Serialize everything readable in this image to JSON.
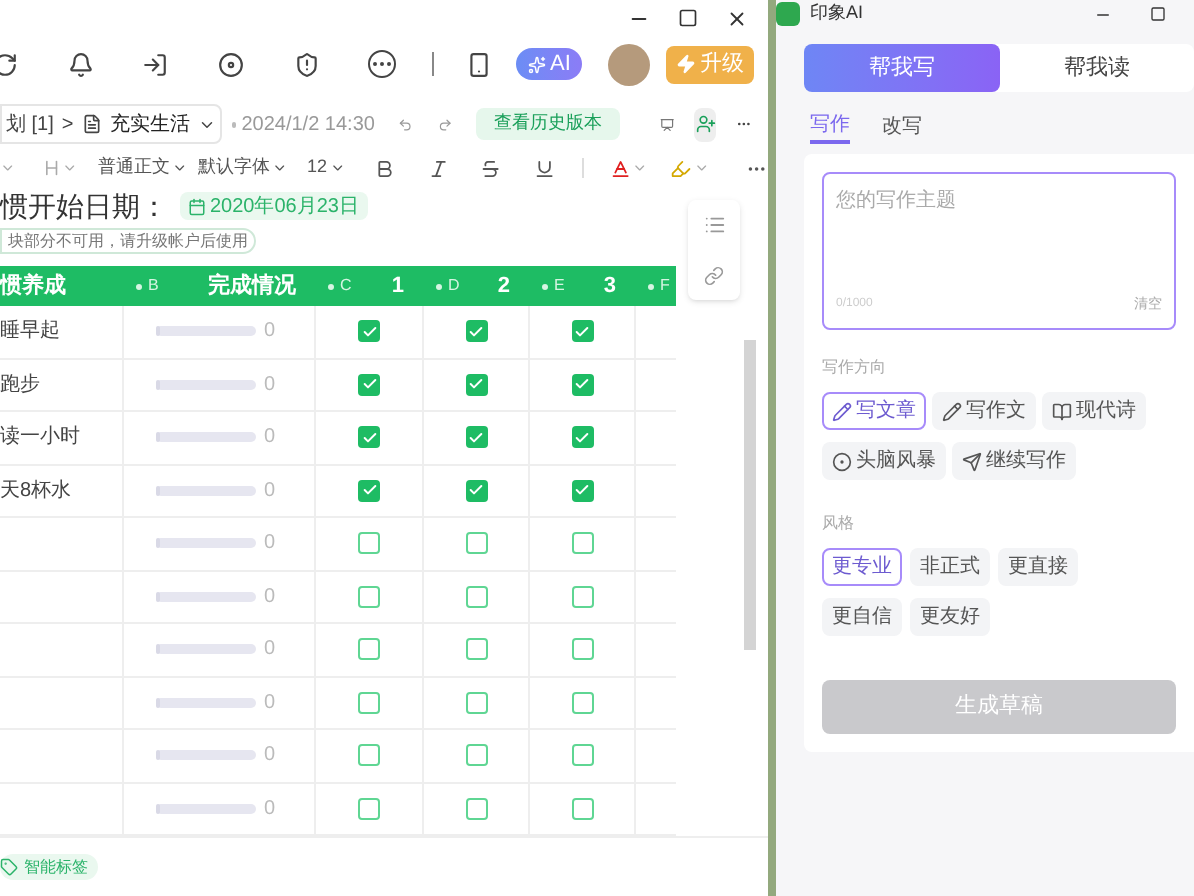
{
  "toolbar": {
    "ai_label": "AI",
    "upgrade_label": "升级"
  },
  "doc_bar": {
    "breadcrumb": "划 [1]",
    "separator": ">",
    "doc_title": "充实生活",
    "timestamp": "2024/1/2 14:30",
    "history_button": "查看历史版本"
  },
  "format_bar": {
    "paragraph_style": "普通正文",
    "font": "默认字体",
    "size": "12"
  },
  "start_date": {
    "label": "惯开始日期：",
    "value": "2020年06月23日"
  },
  "notice": "块部分不可用，请升级帐户后使用",
  "table": {
    "columns": [
      {
        "title": "惯养成"
      },
      {
        "letter": "B",
        "title": "完成情况"
      },
      {
        "letter": "C",
        "title": "1"
      },
      {
        "letter": "D",
        "title": "2"
      },
      {
        "letter": "E",
        "title": "3"
      },
      {
        "letter": "F"
      }
    ],
    "rows": [
      {
        "name": "睡早起",
        "level": 0,
        "count": "0",
        "checks": [
          true,
          true,
          true
        ]
      },
      {
        "name": "跑步",
        "level": 0,
        "count": "0",
        "checks": [
          true,
          true,
          true
        ]
      },
      {
        "name": "读一小时",
        "level": 0,
        "count": "0",
        "checks": [
          true,
          true,
          true
        ]
      },
      {
        "name": "天8杯水",
        "level": 0,
        "count": "0",
        "checks": [
          true,
          true,
          true
        ]
      },
      {
        "level": 0,
        "count": "0",
        "checks": [
          false,
          false,
          false
        ]
      },
      {
        "level": 0,
        "count": "0",
        "checks": [
          false,
          false,
          false
        ]
      },
      {
        "level": 0,
        "count": "0",
        "checks": [
          false,
          false,
          false
        ]
      },
      {
        "level": 0,
        "count": "0",
        "checks": [
          false,
          false,
          false
        ]
      },
      {
        "level": 0,
        "count": "0",
        "checks": [
          false,
          false,
          false
        ]
      },
      {
        "level": 0,
        "count": "0",
        "checks": [
          false,
          false,
          false
        ]
      }
    ]
  },
  "tag_button": "智能标签",
  "ai_panel": {
    "title": "印象AI",
    "tabs": [
      {
        "label": "帮我写",
        "selected": true
      },
      {
        "label": "帮我读",
        "selected": false
      }
    ],
    "subtabs": [
      {
        "label": "写作",
        "selected": true
      },
      {
        "label": "改写",
        "selected": false
      }
    ],
    "textarea": {
      "placeholder": "您的写作主题",
      "counter": "0/1000",
      "clear": "清空"
    },
    "direction_label": "写作方向",
    "directions": [
      {
        "label": "写文章",
        "kind": "pencil",
        "selected": true
      },
      {
        "label": "写作文",
        "kind": "pencil",
        "selected": false
      },
      {
        "label": "现代诗",
        "kind": "book",
        "selected": false
      },
      {
        "label": "头脑风暴",
        "kind": "brain",
        "selected": false
      },
      {
        "label": "继续写作",
        "kind": "continue",
        "selected": false
      }
    ],
    "style_label": "风格",
    "styles": [
      {
        "label": "更专业",
        "selected": true
      },
      {
        "label": "非正式",
        "selected": false
      },
      {
        "label": "更直接",
        "selected": false
      },
      {
        "label": "更自信",
        "selected": false
      },
      {
        "label": "更友好",
        "selected": false
      }
    ],
    "generate_button": {
      "label": "生成草稿",
      "disabled": true
    }
  }
}
